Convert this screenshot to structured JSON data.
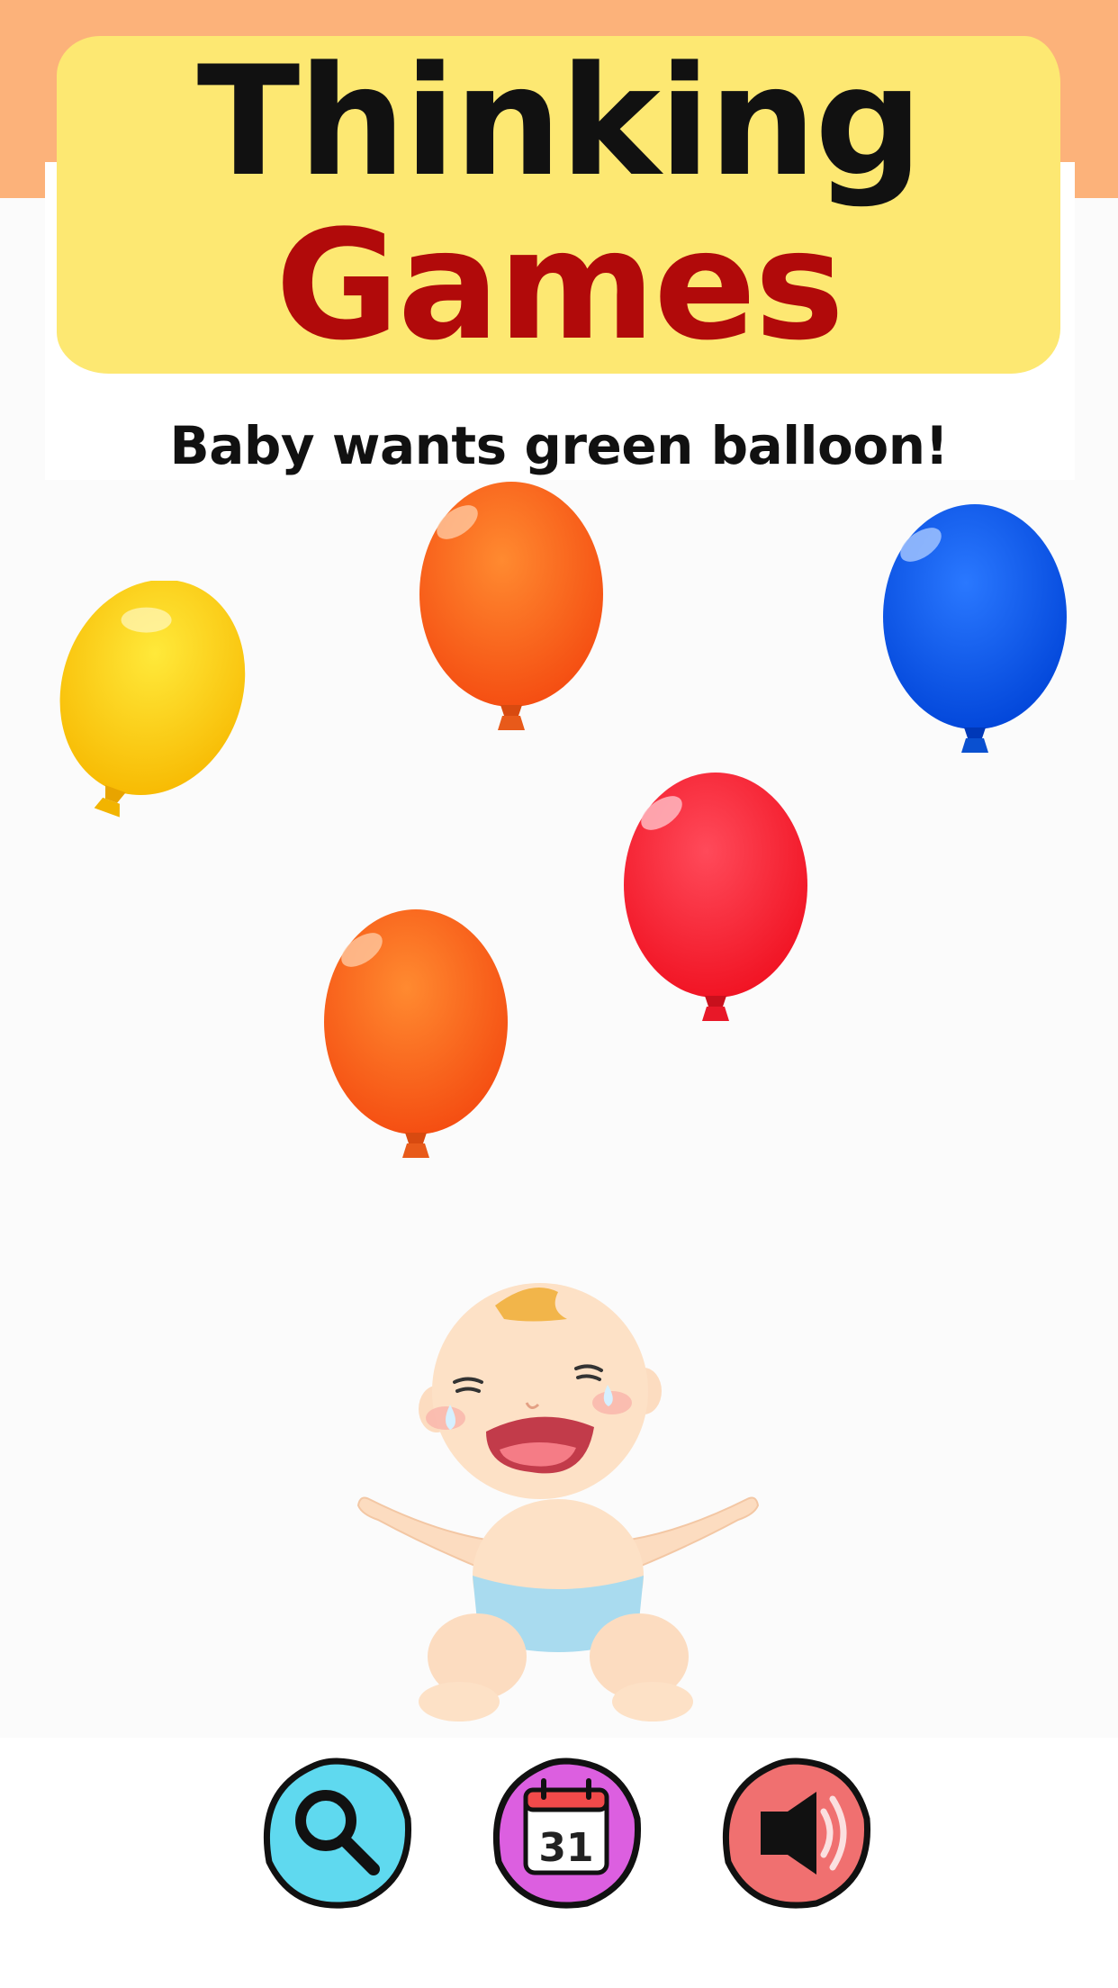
{
  "header": {
    "title_line1": "Thinking",
    "title_line2": "Games"
  },
  "prompt": {
    "text": "Baby wants green balloon!",
    "target_color": "green"
  },
  "balloons": [
    {
      "name": "yellow",
      "color": "#fdd41c"
    },
    {
      "name": "orange",
      "color": "#ff6a1e"
    },
    {
      "name": "blue",
      "color": "#0d5cf0"
    },
    {
      "name": "red",
      "color": "#fb2a3a"
    },
    {
      "name": "orange",
      "color": "#ff6a1e"
    }
  ],
  "baby": {
    "mood": "crying"
  },
  "toolbar": {
    "buttons": [
      {
        "name": "search",
        "icon": "magnifier-icon",
        "color": "#5fd9ef"
      },
      {
        "name": "calendar",
        "icon": "calendar-icon",
        "day": "31",
        "color": "#dc5fe0"
      },
      {
        "name": "audio",
        "icon": "speaker-icon",
        "color": "#f07070"
      }
    ]
  },
  "colors": {
    "header_band": "#fcb27a",
    "title_card": "#fde872",
    "title_line2": "#b10a0a"
  }
}
